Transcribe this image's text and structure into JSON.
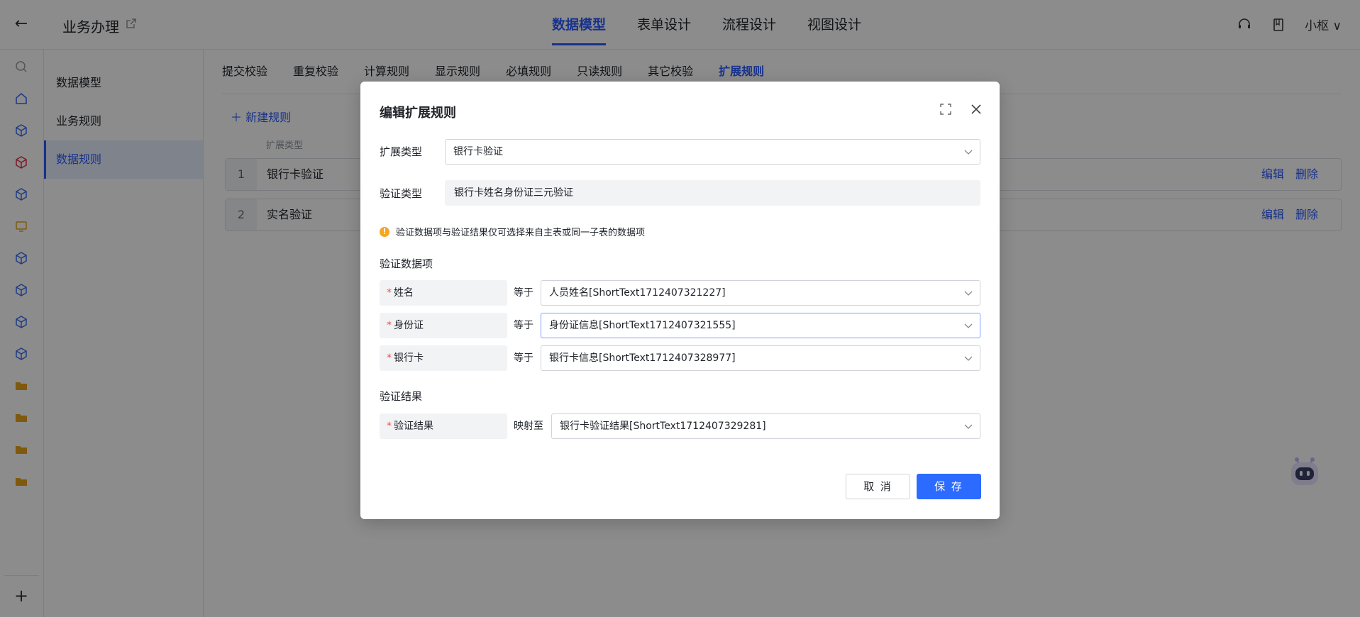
{
  "header": {
    "app_title": "业务办理",
    "tabs": [
      {
        "label": "数据模型",
        "active": true
      },
      {
        "label": "表单设计",
        "active": false
      },
      {
        "label": "流程设计",
        "active": false
      },
      {
        "label": "视图设计",
        "active": false
      }
    ],
    "user": "小枢"
  },
  "side_menu": {
    "items": [
      {
        "label": "数据模型",
        "active": false
      },
      {
        "label": "业务规则",
        "active": false
      },
      {
        "label": "数据规则",
        "active": true
      }
    ]
  },
  "rule_tabs": [
    {
      "label": "提交校验",
      "active": false
    },
    {
      "label": "重复校验",
      "active": false
    },
    {
      "label": "计算规则",
      "active": false
    },
    {
      "label": "显示规则",
      "active": false
    },
    {
      "label": "必填规则",
      "active": false
    },
    {
      "label": "只读规则",
      "active": false
    },
    {
      "label": "其它校验",
      "active": false
    },
    {
      "label": "扩展规则",
      "active": true
    }
  ],
  "rules_list": {
    "new_rule_label": "新建规则",
    "column_header": "扩展类型",
    "rows": [
      {
        "index": "1",
        "name": "银行卡验证",
        "edit": "编辑",
        "delete": "删除"
      },
      {
        "index": "2",
        "name": "实名验证",
        "edit": "编辑",
        "delete": "删除"
      }
    ]
  },
  "modal": {
    "title": "编辑扩展规则",
    "extension_type_label": "扩展类型",
    "extension_type_value": "银行卡验证",
    "verify_type_label": "验证类型",
    "verify_type_value": "银行卡姓名身份证三元验证",
    "tip": "验证数据项与验证结果仅可选择来自主表或同一子表的数据项",
    "data_section": "验证数据项",
    "data_items": [
      {
        "label": "姓名",
        "relation": "等于",
        "value": "人员姓名[ShortText1712407321227]"
      },
      {
        "label": "身份证",
        "relation": "等于",
        "value": "身份证信息[ShortText1712407321555]"
      },
      {
        "label": "银行卡",
        "relation": "等于",
        "value": "银行卡信息[ShortText1712407328977]"
      }
    ],
    "result_section": "验证结果",
    "result_item": {
      "label": "验证结果",
      "relation": "映射至",
      "value": "银行卡验证结果[ShortText1712407329281]"
    },
    "cancel_label": "取 消",
    "save_label": "保 存"
  },
  "colors": {
    "accent": "#2b5cff",
    "primary_button": "#2b6bff",
    "required": "#f54a45",
    "warning": "#f5a623",
    "mask": "rgba(0,0,0,0.45)"
  },
  "icons": [
    "back-arrow-icon",
    "external-link-icon",
    "headset-icon",
    "document-icon",
    "chevron-down-icon",
    "search-icon",
    "home-icon",
    "cube-icon",
    "monitor-icon",
    "folder-icon",
    "plus-icon",
    "fullscreen-icon",
    "close-icon",
    "warning-icon",
    "robot-icon"
  ]
}
